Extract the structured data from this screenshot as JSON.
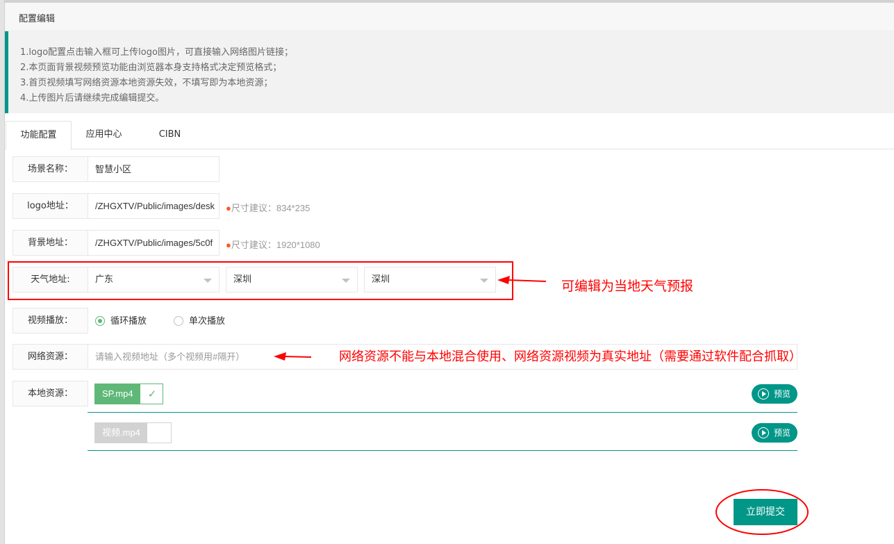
{
  "panel": {
    "title": "配置编辑"
  },
  "notice": {
    "lines": [
      "1.logo配置点击输入框可上传logo图片，可直接输入网络图片链接；",
      "2.本页面背景视频预览功能由浏览器本身支持格式决定预览格式；",
      "3.首页视频填写网络资源本地资源失效，不填写即为本地资源；",
      "4.上传图片后请继续完成编辑提交。"
    ]
  },
  "tabs": [
    {
      "label": "功能配置",
      "active": true
    },
    {
      "label": "应用中心",
      "active": false
    },
    {
      "label": "CIBN",
      "active": false
    }
  ],
  "form": {
    "scene": {
      "label": "场景名称：",
      "value": "智慧小区"
    },
    "logo": {
      "label": "logo地址：",
      "value": "/ZHGXTV/Public/images/desk",
      "hint_dot": "●",
      "hint": "尺寸建议：834*235"
    },
    "background": {
      "label": "背景地址：",
      "value": "/ZHGXTV/Public/images/5c0f",
      "hint_dot": "●",
      "hint": "尺寸建议：1920*1080"
    },
    "weather": {
      "label": "天气地址:",
      "province": "广东",
      "city": "深圳",
      "district": "深圳"
    },
    "video_play": {
      "label": "视频播放：",
      "options": [
        "循环播放",
        "单次播放"
      ],
      "selected": "循环播放"
    },
    "network": {
      "label": "网络资源：",
      "placeholder": "请输入视频地址（多个视频用#隔开）"
    },
    "local": {
      "label": "本地资源：",
      "files": [
        {
          "name": "SP.mp4",
          "checked": true
        },
        {
          "name": "视频.mp4",
          "checked": false
        }
      ],
      "preview_label": "预览"
    }
  },
  "submit_label": "立即提交",
  "annotations": {
    "weather_note": "可编辑为当地天气预报",
    "network_note": "网络资源不能与本地混合使用、网络资源视频为真实地址（需要通过软件配合抓取）",
    "color": "#ff0000"
  },
  "colors": {
    "accent": "#009688",
    "radio_on": "#5fb878",
    "hint_dot": "#ff5722"
  }
}
